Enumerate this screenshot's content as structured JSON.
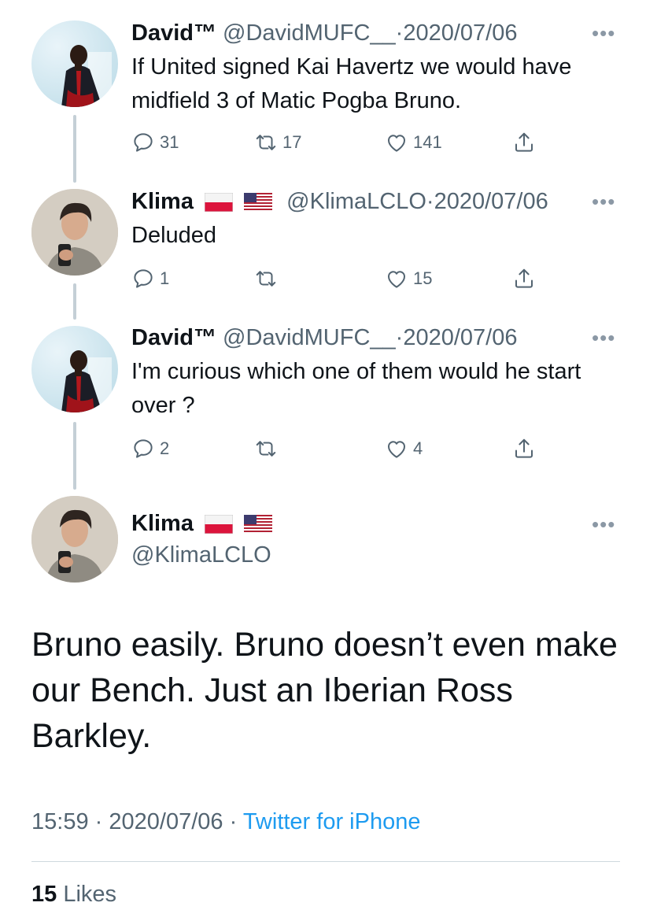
{
  "replies": [
    {
      "name": "David™",
      "handle": "@DavidMUFC__",
      "sep": "·",
      "date": "2020/07/06",
      "text": "If United signed Kai Havertz we would have midfield 3 of Matic Pogba Bruno.",
      "reply_count": "31",
      "retweet_count": "17",
      "like_count": "141",
      "flags": []
    },
    {
      "name": "Klima",
      "handle": "@KlimaLCLO",
      "sep": "·",
      "date": "2020/07/06",
      "text": "Deluded",
      "reply_count": "1",
      "retweet_count": "",
      "like_count": "15",
      "flags": [
        "poland-flag-icon",
        "usa-flag-icon"
      ]
    },
    {
      "name": "David™",
      "handle": "@DavidMUFC__",
      "sep": "·",
      "date": "2020/07/06",
      "text": "I'm curious which one of them would he start over ?",
      "reply_count": "2",
      "retweet_count": "",
      "like_count": "4",
      "flags": []
    }
  ],
  "main_tweet": {
    "name": "Klima",
    "handle": "@KlimaLCLO",
    "text": "Bruno easily. Bruno doesn’t even make our Bench. Just an Iberian Ross Barkley.",
    "time": "15:59",
    "sep": "·",
    "date": "2020/07/06",
    "source": "Twitter for iPhone",
    "likes_count": "15",
    "likes_label": "Likes",
    "flags": [
      "poland-flag-icon",
      "usa-flag-icon"
    ]
  },
  "more_glyph": "•••",
  "colors": {
    "accent": "#1d9bf0",
    "secondary_text": "#536471",
    "thread_line": "#c4cfd6"
  }
}
